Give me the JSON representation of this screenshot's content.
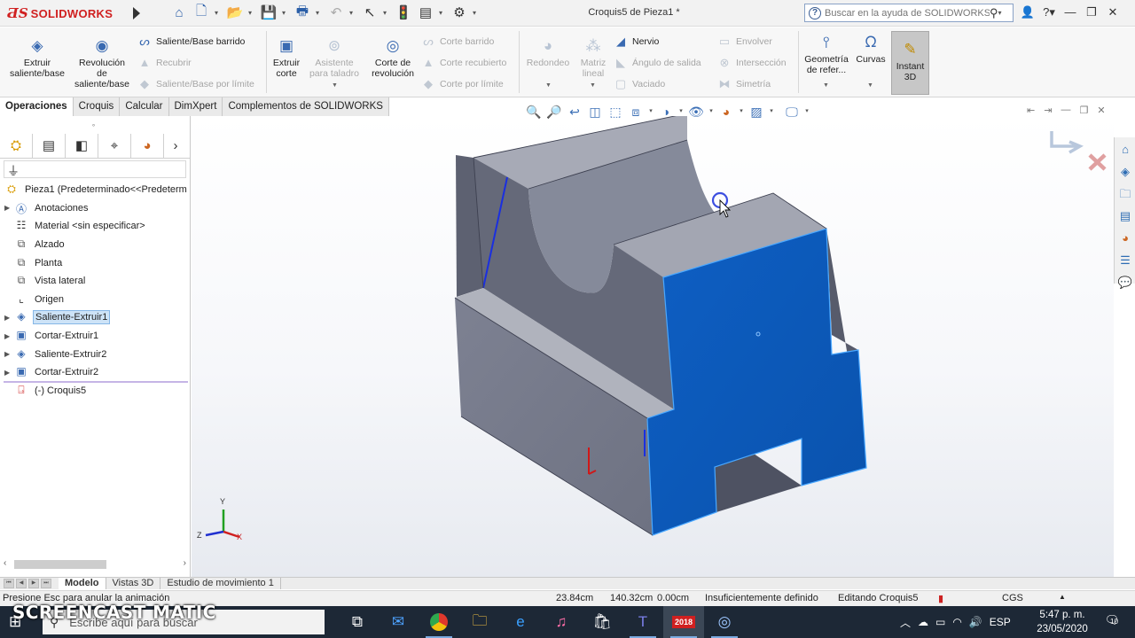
{
  "titlebar": {
    "app_name": "SOLIDWORKS",
    "doc_title": "Croquis5 de Pieza1 *",
    "help_search_placeholder": "Buscar en la ayuda de SOLIDWORKS",
    "icons": [
      "home-icon",
      "new-icon",
      "open-icon",
      "save-icon",
      "print-icon",
      "undo-icon",
      "select-icon",
      "rebuild-icon",
      "file-properties-icon",
      "options-icon"
    ]
  },
  "ribbon": {
    "extruir_saliente": "Extruir saliente/base",
    "revolucion_saliente": "Revolución de saliente/base",
    "saliente_barrido": "Saliente/Base barrido",
    "recubrir": "Recubrir",
    "saliente_limite": "Saliente/Base por límite",
    "extruir_corte": "Extruir corte",
    "asistente_taladro": "Asistente para taladro",
    "corte_revolucion": "Corte de revolución",
    "corte_barrido": "Corte barrido",
    "corte_recubierto": "Corte recubierto",
    "corte_limite": "Corte por límite",
    "redondeo": "Redondeo",
    "matriz_lineal": "Matriz lineal",
    "nervio": "Nervio",
    "angulo_salida": "Ángulo de salida",
    "vaciado": "Vaciado",
    "envolver": "Envolver",
    "interseccion": "Intersección",
    "simetria": "Simetría",
    "geometria_ref": "Geometría de refer...",
    "curvas": "Curvas",
    "instant3d": "Instant 3D"
  },
  "cm_tabs": [
    "Operaciones",
    "Croquis",
    "Calcular",
    "DimXpert",
    "Complementos de SOLIDWORKS"
  ],
  "tree": {
    "root": "Pieza1  (Predeterminado<<Predeterm",
    "items": [
      {
        "label": "Anotaciones",
        "icon": "annotations-icon"
      },
      {
        "label": "Material <sin especificar>",
        "icon": "material-icon"
      },
      {
        "label": "Alzado",
        "icon": "plane-icon"
      },
      {
        "label": "Planta",
        "icon": "plane-icon"
      },
      {
        "label": "Vista lateral",
        "icon": "plane-icon"
      },
      {
        "label": "Origen",
        "icon": "origin-icon"
      },
      {
        "label": "Saliente-Extruir1",
        "icon": "extrude-icon"
      },
      {
        "label": "Cortar-Extruir1",
        "icon": "cut-extrude-icon"
      },
      {
        "label": "Saliente-Extruir2",
        "icon": "extrude-icon"
      },
      {
        "label": "Cortar-Extruir2",
        "icon": "cut-extrude-icon"
      },
      {
        "label": "(-) Croquis5",
        "icon": "sketch-icon"
      }
    ]
  },
  "triad": {
    "y": "Y",
    "x": "X",
    "z": "Z"
  },
  "bottom_tabs": [
    "Modelo",
    "Vistas 3D",
    "Estudio de movimiento 1"
  ],
  "status": {
    "message": "Presione Esc para anular la animación",
    "coord1": "23.84cm",
    "coord2": "140.32cm",
    "coord3": "0.00cm",
    "sketch_state": "Insuficientemente definido",
    "editing": "Editando Croquis5",
    "units": "CGS"
  },
  "taskbar": {
    "search_placeholder": "Escribe aquí para buscar",
    "lang": "ESP",
    "time": "5:47 p. m.",
    "date": "23/05/2020",
    "notifications": "10",
    "solidworks_badge": "2018"
  },
  "watermark": "SCREENCAST MATIC",
  "colors": {
    "face_blue": "#0b5bbd",
    "body_gray": "#7b7f8e",
    "accent_red": "#d02020"
  }
}
